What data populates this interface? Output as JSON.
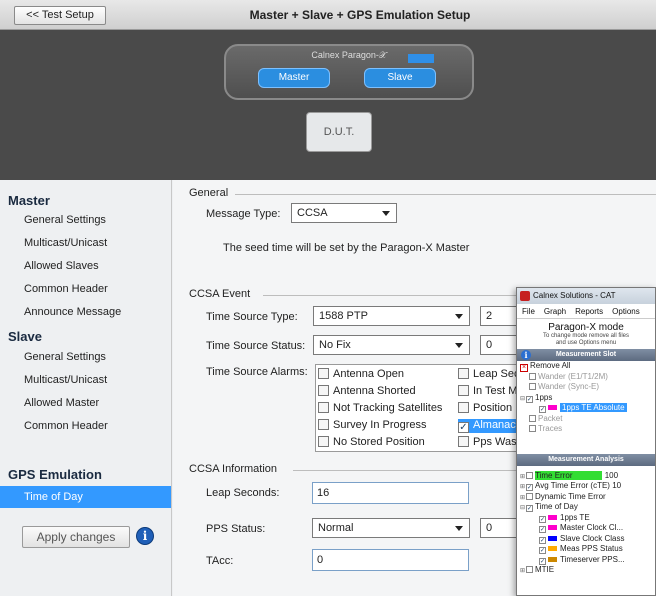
{
  "topbar": {
    "back_label": "<< Test Setup",
    "title": "Master + Slave + GPS Emulation Setup"
  },
  "device": {
    "name": "Calnex Paragon-𝒳",
    "master_port": "Master",
    "slave_port": "Slave",
    "dut_label": "D.U.T."
  },
  "sidebar": {
    "master_heading": "Master",
    "master_items": [
      "General Settings",
      "Multicast/Unicast",
      "Allowed Slaves",
      "Common Header",
      "Announce Message"
    ],
    "slave_heading": "Slave",
    "slave_items": [
      "General Settings",
      "Multicast/Unicast",
      "Allowed Master",
      "Common Header"
    ],
    "gps_heading": "GPS Emulation",
    "gps_items": [
      "Time of Day"
    ],
    "selected_item": "Time of Day",
    "apply_label": "Apply changes"
  },
  "general": {
    "group": "General",
    "message_type_label": "Message Type:",
    "message_type_value": "CCSA",
    "note": "The seed time will be set by the Paragon-X Master"
  },
  "ccsa_event": {
    "group": "CCSA Event",
    "source_type_label": "Time Source Type:",
    "source_type_value": "1588 PTP",
    "source_type_extra": "2",
    "source_status_label": "Time Source Status:",
    "source_status_value": "No Fix",
    "source_status_extra": "0",
    "alarms_label": "Time Source Alarms:",
    "alarms_col1": [
      "Antenna Open",
      "Antenna Shorted",
      "Not Tracking Satellites",
      "Survey In Progress",
      "No Stored Position"
    ],
    "alarms_col2": [
      "Leap Seco",
      "In Test M",
      "Position I",
      "Almanac",
      "Pps Was"
    ],
    "alarms_col2_checked": [
      false,
      false,
      false,
      true,
      false
    ],
    "selected_alarm": "Almanac"
  },
  "ccsa_info": {
    "group": "CCSA Information",
    "leap_label": "Leap Seconds:",
    "leap_value": "16",
    "pps_label": "PPS Status:",
    "pps_value": "Normal",
    "pps_extra": "0",
    "tacc_label": "TAcc:",
    "tacc_value": "0"
  },
  "cat": {
    "title": "Calnex Solutions - CAT",
    "menu": [
      "File",
      "Graph",
      "Reports",
      "Options"
    ],
    "mode": "Paragon-X mode",
    "hint_1": "To change mode remove all files",
    "hint_2": "and use Options menu",
    "slot_header": "Measurement Slot",
    "remove_all": "Remove All",
    "slot_items": [
      {
        "label": "Wander (E1/T1/2M)",
        "dim": true,
        "checked": false
      },
      {
        "label": "Wander (Sync-E)",
        "dim": true,
        "checked": false
      },
      {
        "label": "1pps",
        "dim": false,
        "checked": true
      },
      {
        "label": "1pps TE Absolute",
        "dim": false,
        "checked": true
      },
      {
        "label": "Packet",
        "dim": true,
        "checked": false
      },
      {
        "label": "Traces",
        "dim": true,
        "checked": false
      }
    ],
    "analysis_header": "Measurement Analysis",
    "analysis_items": [
      {
        "label": "Time Error",
        "suffix": "100",
        "checked": false,
        "color": ""
      },
      {
        "label": "Avg Time Error (cTE)",
        "suffix": "10",
        "checked": true,
        "color": ""
      },
      {
        "label": "Dynamic Time Error",
        "suffix": "",
        "checked": false,
        "color": ""
      },
      {
        "label": "Time of Day",
        "suffix": "",
        "checked": true,
        "color": ""
      },
      {
        "label": "1pps TE",
        "suffix": "",
        "checked": true,
        "color": "#ff00cc"
      },
      {
        "label": "Master Clock Cl...",
        "suffix": "",
        "checked": true,
        "color": "#ff00cc"
      },
      {
        "label": "Slave Clock Class",
        "suffix": "",
        "checked": true,
        "color": "#0000ff"
      },
      {
        "label": "Meas PPS Status",
        "suffix": "",
        "checked": true,
        "color": "#ffaa00"
      },
      {
        "label": "Timeserver PPS...",
        "suffix": "",
        "checked": true,
        "color": "#cc8800"
      },
      {
        "label": "MTIE",
        "suffix": "",
        "checked": false,
        "color": ""
      }
    ],
    "colors": {
      "selection": "#3399ff",
      "highlight_green": "#33dd33",
      "bar": "#6b7a90"
    }
  },
  "colors": {
    "accent": "#3399ff",
    "hero_bg": "#4a4a4a",
    "port_blue": "#2b8ee0"
  }
}
